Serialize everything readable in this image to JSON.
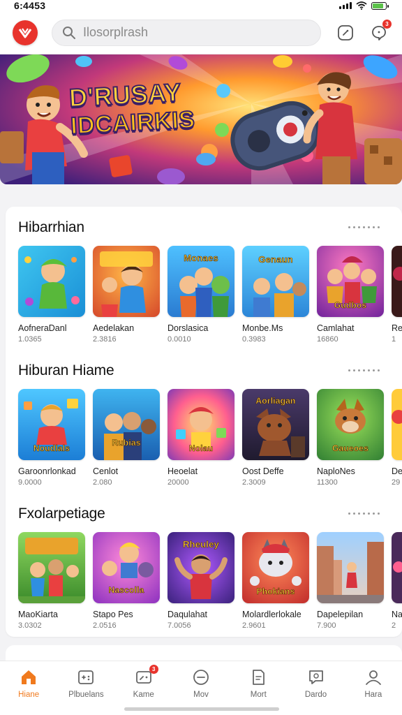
{
  "status_bar": {
    "time": "6:4453",
    "battery_level": 0.85
  },
  "header": {
    "search_placeholder": "Ilosorplrash",
    "notification_count": "3"
  },
  "banner": {
    "title_line1": "D'RUSAY",
    "title_line2": "IDCAIRKIS"
  },
  "sections": [
    {
      "title": "Hibarrhian",
      "items": [
        {
          "name": "AofneraDanl",
          "stat": "1.0365"
        },
        {
          "name": "Aedelakan",
          "stat": "2.3816"
        },
        {
          "name": "Dorslasica",
          "stat": "0.0010"
        },
        {
          "name": "Monbe.Ms",
          "stat": "0.3983"
        },
        {
          "name": "Camlahat",
          "stat": "16860"
        },
        {
          "name": "Re",
          "stat": "1"
        }
      ]
    },
    {
      "title": "Hiburan Hiame",
      "items": [
        {
          "name": "Garoonrlonkad",
          "stat": "9.0000"
        },
        {
          "name": "Cenlot",
          "stat": "2.080"
        },
        {
          "name": "Heoelat",
          "stat": "20000"
        },
        {
          "name": "Oost Deffe",
          "stat": "2.3009"
        },
        {
          "name": "NaploNes",
          "stat": "11300"
        },
        {
          "name": "De",
          "stat": "29"
        }
      ]
    },
    {
      "title": "Fxolarpetiage",
      "items": [
        {
          "name": "MaoKiarta",
          "stat": "3.0302"
        },
        {
          "name": "Stapo Pes",
          "stat": "2.0516"
        },
        {
          "name": "Daqulahat",
          "stat": "7.0056"
        },
        {
          "name": "Molardlerlokale",
          "stat": "2.9601"
        },
        {
          "name": "Dapelepilan",
          "stat": "7.900"
        },
        {
          "name": "Na",
          "stat": "2"
        }
      ]
    }
  ],
  "tile_captions": [
    [
      "",
      "",
      "Monaes",
      "Genaun",
      "Gudbos",
      ""
    ],
    [
      "Noudlals",
      "Rubias",
      "Nolau",
      "Aorliagan",
      "Gaueoes",
      ""
    ],
    [
      "",
      "Nascolla",
      "Rheuley",
      "Phokians",
      "",
      ""
    ]
  ],
  "bottom_nav": [
    {
      "label": "Hiane",
      "icon": "home-icon",
      "active": true
    },
    {
      "label": "Plbuelans",
      "icon": "controller-icon",
      "active": false
    },
    {
      "label": "Kame",
      "icon": "gamepad-icon",
      "active": false,
      "badge": "3"
    },
    {
      "label": "Mov",
      "icon": "minus-circle-icon",
      "active": false
    },
    {
      "label": "Mort",
      "icon": "document-icon",
      "active": false
    },
    {
      "label": "Dardo",
      "icon": "chat-icon",
      "active": false
    },
    {
      "label": "Hara",
      "icon": "user-icon",
      "active": false
    }
  ],
  "colors": {
    "brand": "#e8332c",
    "active_nav": "#f07a1e"
  }
}
